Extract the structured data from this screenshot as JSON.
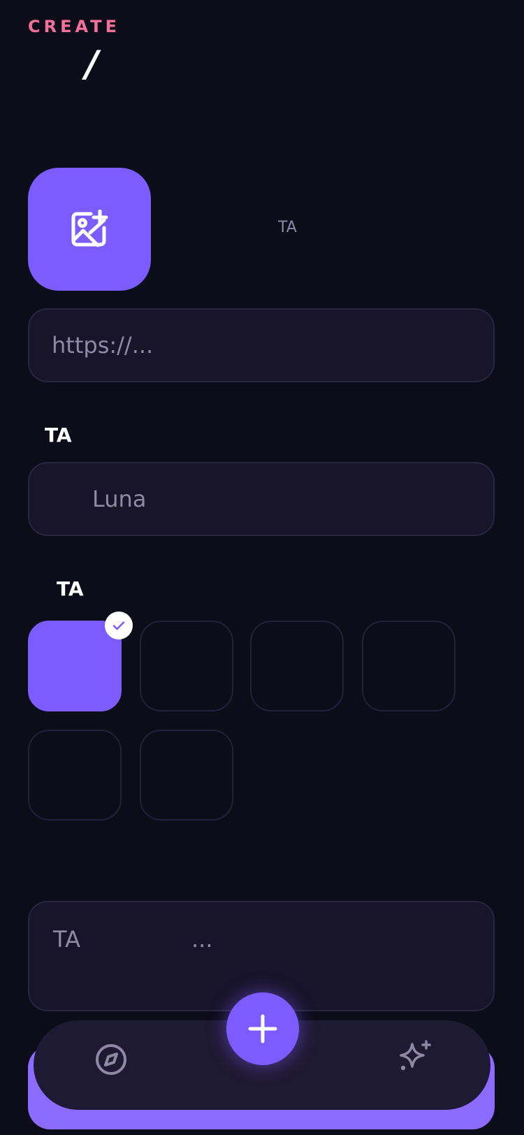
{
  "header": {
    "eyebrow": "CREATE",
    "title": "/"
  },
  "cover": {
    "icon": "image-add-icon",
    "hint": "TA"
  },
  "url_field": {
    "placeholder": "https://..."
  },
  "name_section": {
    "label": "TA",
    "placeholder": "Luna"
  },
  "color_section": {
    "label": "TA",
    "selected_index": 0,
    "accent_color": "#7c5cff"
  },
  "description": {
    "prefix": "TA",
    "ellipsis": "..."
  },
  "nav": {
    "left_icon": "compass-icon",
    "center_icon": "plus-icon",
    "right_icon": "sparkle-icon"
  }
}
